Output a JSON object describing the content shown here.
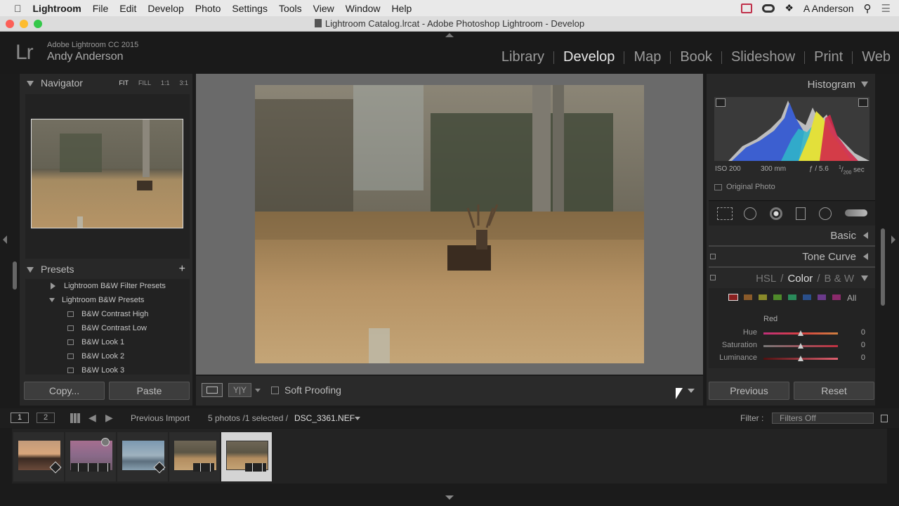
{
  "menubar": {
    "app": "Lightroom",
    "items": [
      "File",
      "Edit",
      "Develop",
      "Photo",
      "Settings",
      "Tools",
      "View",
      "Window",
      "Help"
    ],
    "user": "A Anderson"
  },
  "window": {
    "title": "Lightroom Catalog.lrcat - Adobe Photoshop Lightroom - Develop"
  },
  "identity": {
    "logo": "Lr",
    "product": "Adobe Lightroom CC 2015",
    "user": "Andy Anderson"
  },
  "modules": [
    "Library",
    "Develop",
    "Map",
    "Book",
    "Slideshow",
    "Print",
    "Web"
  ],
  "active_module": "Develop",
  "navigator": {
    "title": "Navigator",
    "zoom": [
      "FIT",
      "FILL",
      "1:1",
      "3:1"
    ]
  },
  "presets": {
    "title": "Presets",
    "add": "+",
    "folders": [
      {
        "label": "Lightroom B&W Filter Presets",
        "expanded": false
      },
      {
        "label": "Lightroom B&W Presets",
        "expanded": true
      }
    ],
    "items": [
      "B&W Contrast High",
      "B&W Contrast Low",
      "B&W Look 1",
      "B&W Look 2",
      "B&W Look 3"
    ]
  },
  "left_buttons": {
    "copy": "Copy...",
    "paste": "Paste"
  },
  "toolbar": {
    "soft_proofing": "Soft Proofing",
    "compare": "Y|Y"
  },
  "histogram": {
    "title": "Histogram",
    "iso": "ISO 200",
    "focal": "300 mm",
    "aperture": "ƒ / 5.6",
    "shutter_num": "1",
    "shutter_den": "200",
    "shutter_unit": "sec",
    "original": "Original Photo"
  },
  "panels": {
    "basic": "Basic",
    "tone_curve": "Tone Curve",
    "hsl": "HSL",
    "sep1": "/",
    "color": "Color",
    "sep2": "/",
    "bw": "B & W"
  },
  "color_panel": {
    "all": "All",
    "selected": "Red",
    "sliders": [
      {
        "label": "Hue",
        "value": "0"
      },
      {
        "label": "Saturation",
        "value": "0"
      },
      {
        "label": "Luminance",
        "value": "0"
      }
    ],
    "swatches": [
      "#8a2020",
      "#8a5a2a",
      "#8a8a2a",
      "#4f8a2a",
      "#2a8a5a",
      "#2a4f8a",
      "#6a3a8a",
      "#8a2a6a"
    ]
  },
  "right_buttons": {
    "previous": "Previous",
    "reset": "Reset"
  },
  "filmbar": {
    "view1": "1",
    "view2": "2",
    "source": "Previous Import",
    "count": "5 photos /1 selected /",
    "file": "DSC_3361.NEF",
    "filter_label": "Filter :",
    "filter_value": "Filters Off"
  }
}
